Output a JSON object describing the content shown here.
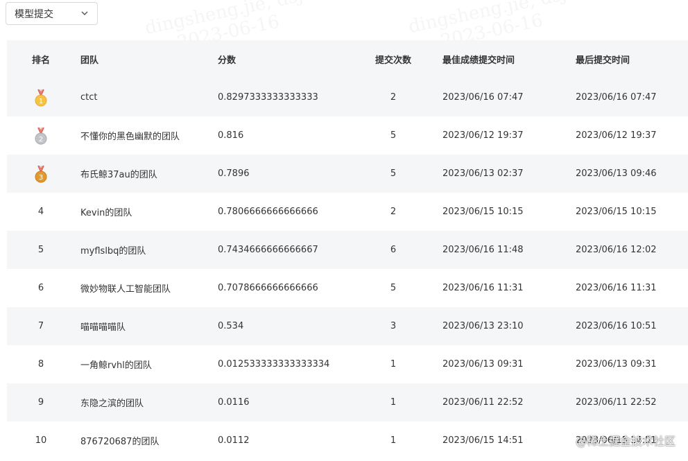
{
  "selector": {
    "value": "模型提交"
  },
  "table": {
    "headers": {
      "rank": "排名",
      "team": "团队",
      "score": "分数",
      "count": "提交次数",
      "best_time": "最佳成绩提交时间",
      "last_time": "最后提交时间"
    },
    "rows": [
      {
        "rank": "1",
        "medal": "gold-medal-icon",
        "team": "ctct",
        "score": "0.8297333333333333",
        "count": "2",
        "best_time": "2023/06/16 07:47",
        "last_time": "2023/06/16 07:47"
      },
      {
        "rank": "2",
        "medal": "silver-medal-icon",
        "team": "不懂你的黑色幽默的团队",
        "score": "0.816",
        "count": "5",
        "best_time": "2023/06/12 19:37",
        "last_time": "2023/06/12 19:37"
      },
      {
        "rank": "3",
        "medal": "bronze-medal-icon",
        "team": "布氏鲸37au的团队",
        "score": "0.7896",
        "count": "5",
        "best_time": "2023/06/13 02:37",
        "last_time": "2023/06/13 09:46"
      },
      {
        "rank": "4",
        "medal": "",
        "team": "Kevin的团队",
        "score": "0.7806666666666666",
        "count": "2",
        "best_time": "2023/06/15 10:15",
        "last_time": "2023/06/15 10:15"
      },
      {
        "rank": "5",
        "medal": "",
        "team": "myflslbq的团队",
        "score": "0.7434666666666667",
        "count": "6",
        "best_time": "2023/06/16 11:48",
        "last_time": "2023/06/16 12:02"
      },
      {
        "rank": "6",
        "medal": "",
        "team": "微妙物联人工智能团队",
        "score": "0.7078666666666666",
        "count": "5",
        "best_time": "2023/06/16 11:31",
        "last_time": "2023/06/16 11:31"
      },
      {
        "rank": "7",
        "medal": "",
        "team": "喵喵喵喵队",
        "score": "0.534",
        "count": "3",
        "best_time": "2023/06/13 23:10",
        "last_time": "2023/06/16 10:51"
      },
      {
        "rank": "8",
        "medal": "",
        "team": "一角鲸rvhl的团队",
        "score": "0.012533333333333334",
        "count": "1",
        "best_time": "2023/06/13 09:31",
        "last_time": "2023/06/13 09:31"
      },
      {
        "rank": "9",
        "medal": "",
        "team": "东隐之滨的团队",
        "score": "0.0116",
        "count": "1",
        "best_time": "2023/06/11 22:52",
        "last_time": "2023/06/11 22:52"
      },
      {
        "rank": "10",
        "medal": "",
        "team": "876720687的团队",
        "score": "0.0112",
        "count": "1",
        "best_time": "2023/06/15 14:51",
        "last_time": "2023/06/15 14:51"
      }
    ]
  },
  "watermark": {
    "line1": "dingsheng.jie, dsj",
    "line2": "2023-06-16"
  },
  "credit": "@稀土掘金技术社区"
}
